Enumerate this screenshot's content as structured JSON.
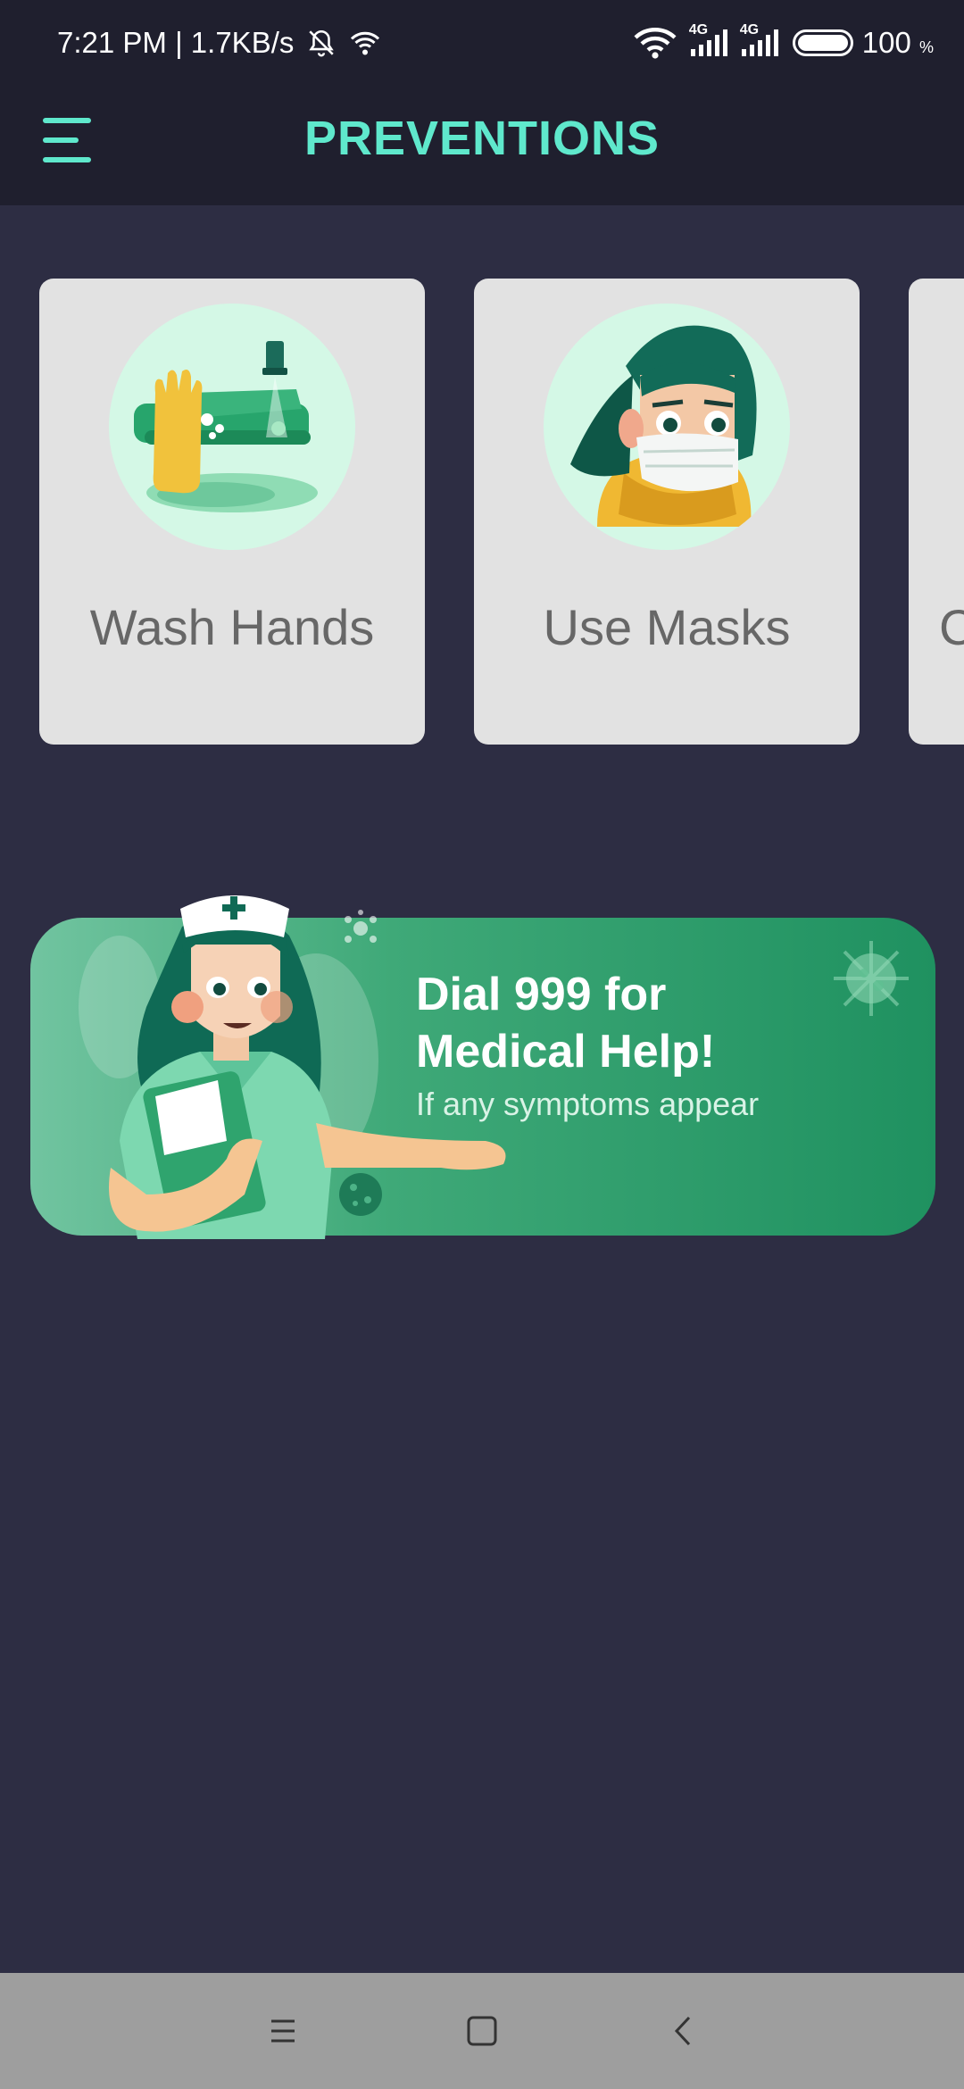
{
  "status_bar": {
    "time_speed": "7:21 PM | 1.7KB/s",
    "network_1": "4G",
    "network_2": "4G",
    "battery": "100",
    "battery_unit": "%"
  },
  "header": {
    "title": "PREVENTIONS",
    "menu_icon": "hamburger-menu-icon"
  },
  "prevention_cards": [
    {
      "label": "Wash Hands",
      "icon": "wash-hands-illustration"
    },
    {
      "label": "Use Masks",
      "icon": "mask-woman-illustration"
    },
    {
      "label": "C",
      "icon": "partial-card"
    }
  ],
  "banner": {
    "title_line1": "Dial 999 for",
    "title_line2": "Medical Help!",
    "subtitle": "If any symptoms appear",
    "illustration": "nurse-illustration"
  },
  "nav_bar": {
    "recents_icon": "recents-icon",
    "home_icon": "home-icon",
    "back_icon": "back-icon"
  },
  "colors": {
    "background": "#2d2d43",
    "app_bar": "#1f1f2e",
    "accent": "#5fe8cc",
    "card": "#e2e2e2",
    "banner_start": "#71c4a0",
    "banner_end": "#1f9160"
  }
}
